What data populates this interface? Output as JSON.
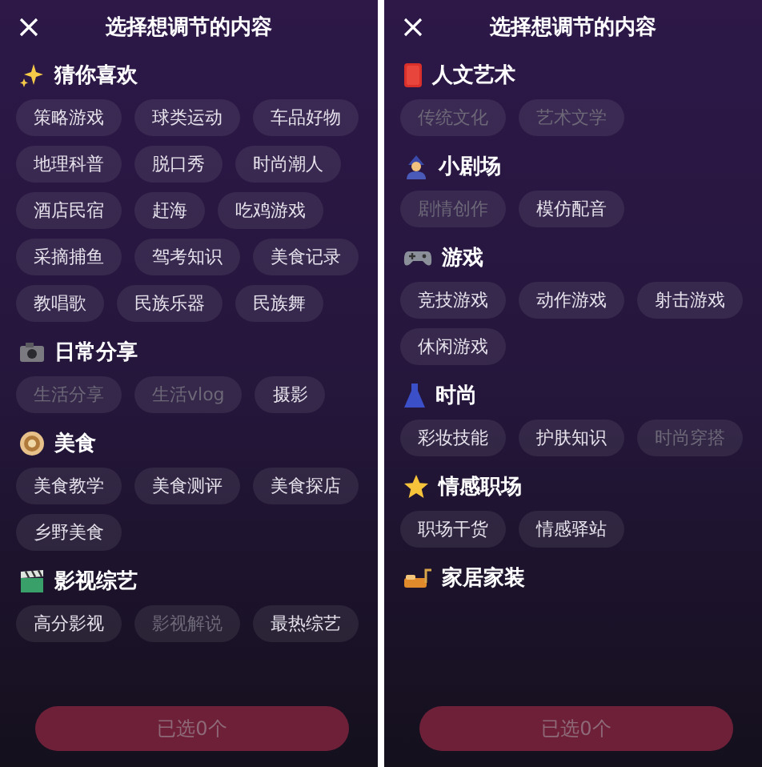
{
  "panels": [
    {
      "title": "选择想调节的内容",
      "sections": [
        {
          "title": "猜你喜欢",
          "chips": [
            {
              "label": "策略游戏",
              "disabled": false
            },
            {
              "label": "球类运动",
              "disabled": false
            },
            {
              "label": "车品好物",
              "disabled": false
            },
            {
              "label": "地理科普",
              "disabled": false
            },
            {
              "label": "脱口秀",
              "disabled": false
            },
            {
              "label": "时尚潮人",
              "disabled": false
            },
            {
              "label": "酒店民宿",
              "disabled": false
            },
            {
              "label": "赶海",
              "disabled": false
            },
            {
              "label": "吃鸡游戏",
              "disabled": false
            },
            {
              "label": "采摘捕鱼",
              "disabled": false
            },
            {
              "label": "驾考知识",
              "disabled": false
            },
            {
              "label": "美食记录",
              "disabled": false
            },
            {
              "label": "教唱歌",
              "disabled": false
            },
            {
              "label": "民族乐器",
              "disabled": false
            },
            {
              "label": "民族舞",
              "disabled": false
            }
          ]
        },
        {
          "title": "日常分享",
          "chips": [
            {
              "label": "生活分享",
              "disabled": true
            },
            {
              "label": "生活vlog",
              "disabled": true
            },
            {
              "label": "摄影",
              "disabled": false
            }
          ]
        },
        {
          "title": "美食",
          "chips": [
            {
              "label": "美食教学",
              "disabled": false
            },
            {
              "label": "美食测评",
              "disabled": false
            },
            {
              "label": "美食探店",
              "disabled": false
            },
            {
              "label": "乡野美食",
              "disabled": false
            }
          ]
        },
        {
          "title": "影视综艺",
          "chips": [
            {
              "label": "高分影视",
              "disabled": false
            },
            {
              "label": "影视解说",
              "disabled": true
            },
            {
              "label": "最热综艺",
              "disabled": false
            }
          ]
        }
      ],
      "button": {
        "label": "已选0个",
        "disabled": true
      }
    },
    {
      "title": "选择想调节的内容",
      "sections": [
        {
          "title": "人文艺术",
          "chips": [
            {
              "label": "传统文化",
              "disabled": true
            },
            {
              "label": "艺术文学",
              "disabled": true
            }
          ]
        },
        {
          "title": "小剧场",
          "chips": [
            {
              "label": "剧情创作",
              "disabled": true
            },
            {
              "label": "模仿配音",
              "disabled": false
            }
          ]
        },
        {
          "title": "游戏",
          "chips": [
            {
              "label": "竞技游戏",
              "disabled": false
            },
            {
              "label": "动作游戏",
              "disabled": false
            },
            {
              "label": "射击游戏",
              "disabled": false
            },
            {
              "label": "休闲游戏",
              "disabled": false
            }
          ]
        },
        {
          "title": "时尚",
          "chips": [
            {
              "label": "彩妆技能",
              "disabled": false
            },
            {
              "label": "护肤知识",
              "disabled": false
            },
            {
              "label": "时尚穿搭",
              "disabled": true
            }
          ]
        },
        {
          "title": "情感职场",
          "chips": [
            {
              "label": "职场干货",
              "disabled": false
            },
            {
              "label": "情感驿站",
              "disabled": false
            }
          ]
        },
        {
          "title": "家居家装"
        }
      ],
      "button": {
        "label": "已选0个",
        "disabled": true
      }
    }
  ]
}
